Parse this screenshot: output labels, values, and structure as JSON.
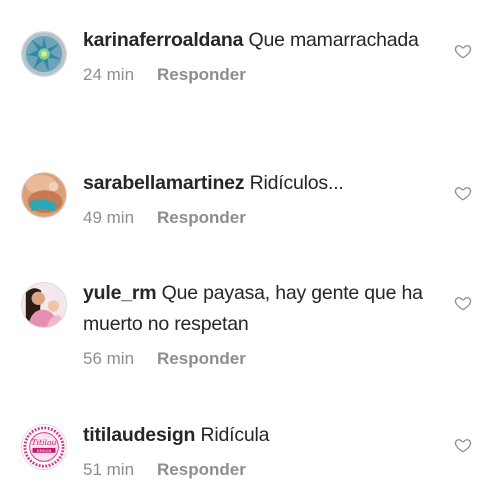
{
  "comments": [
    {
      "username": "karinaferroaldana",
      "text": "Que mamarrachada",
      "time": "24 min",
      "reply_label": "Responder"
    },
    {
      "username": "sarabellamartinez",
      "text": "Ridículos...",
      "time": "49 min",
      "reply_label": "Responder"
    },
    {
      "username": "yule_rm",
      "text": "Que payasa, hay gente que ha muerto no respetan",
      "time": "56 min",
      "reply_label": "Responder"
    },
    {
      "username": "titilaudesign",
      "text": "Ridícula",
      "time": "51 min",
      "reply_label": "Responder"
    }
  ],
  "avatar_logo_text": "Titilau Design",
  "icons": {
    "like": "heart-outline-icon"
  },
  "colors": {
    "username": "#262626",
    "secondary": "#8e8e8e"
  }
}
